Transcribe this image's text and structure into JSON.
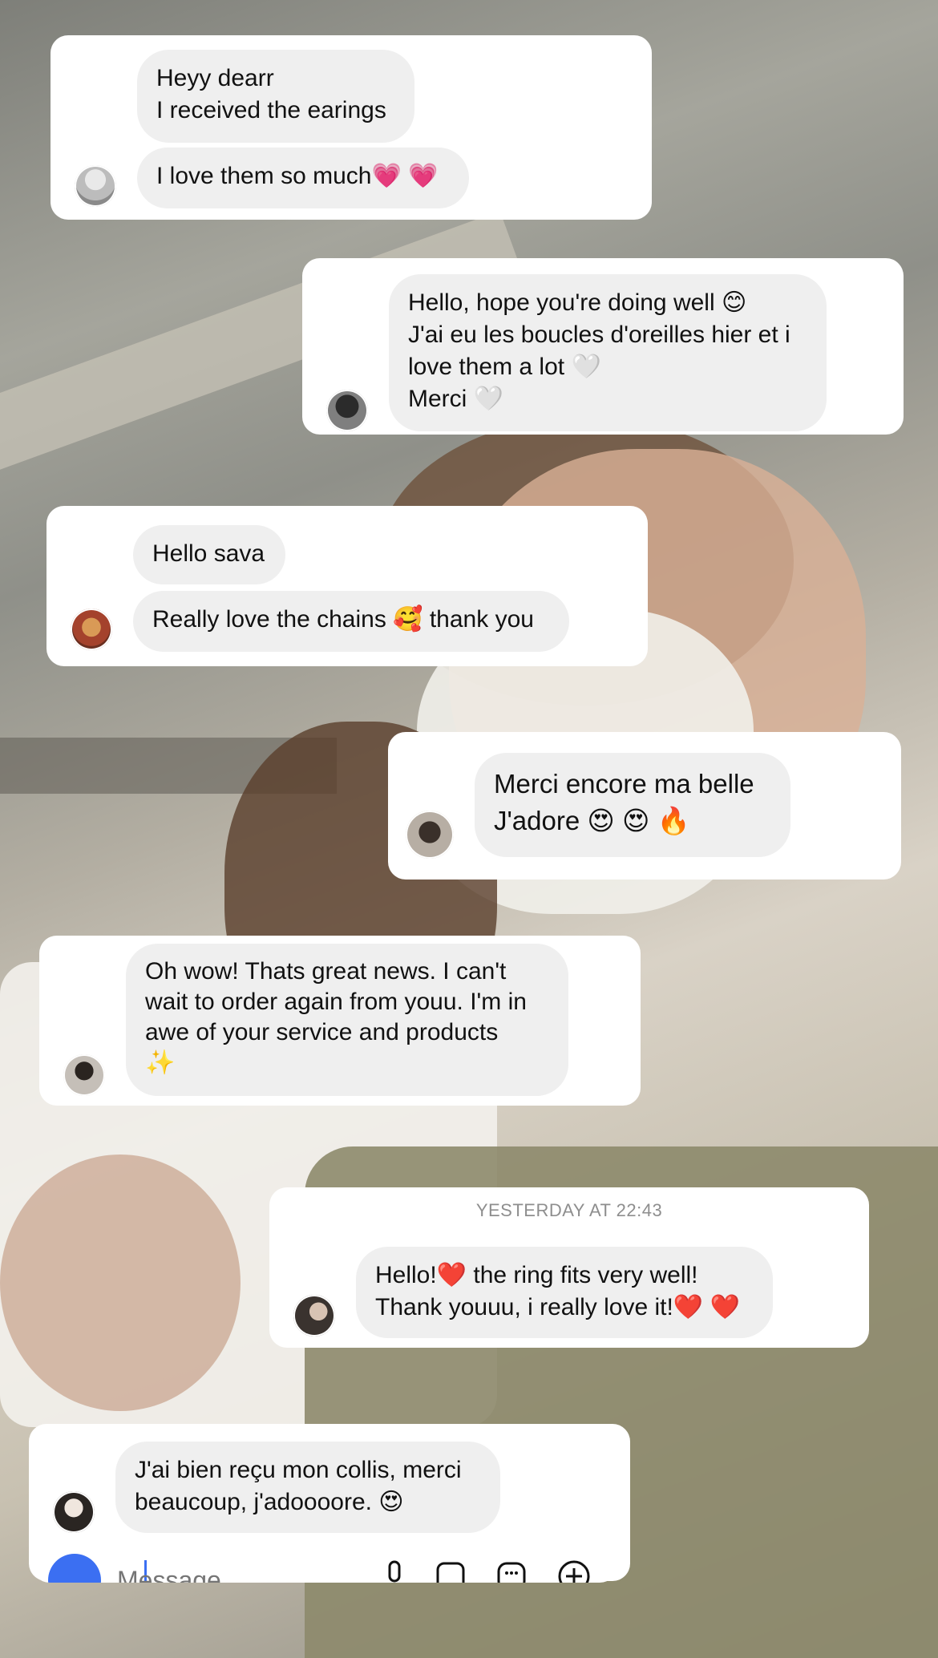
{
  "conversations": [
    {
      "messages": [
        "Heyy dearr\nI received the earings",
        "I love them so much💗 💗"
      ]
    },
    {
      "messages": [
        "Hello, hope you're doing well 😊\nJ'ai eu les boucles d'oreilles hier et i\nlove them a lot 🤍\nMerci 🤍"
      ]
    },
    {
      "messages": [
        "Hello sava",
        "Really love the chains 🥰 thank you"
      ]
    },
    {
      "messages": [
        "Merci encore ma belle\nJ'adore 😍 😍 🔥"
      ]
    },
    {
      "messages": [
        "Oh wow! Thats great news. I can't\nwait to order again from youu. I'm in\nawe of your service and products\n✨"
      ]
    },
    {
      "timestamp": "YESTERDAY AT 22:43",
      "messages": [
        "Hello!❤️  the ring fits very well!\nThank youuu, i really love it!❤️ ❤️"
      ]
    },
    {
      "messages": [
        "J'ai bien reçu mon collis, merci\nbeaucoup, j'adoooore. 😍"
      ]
    }
  ],
  "composer": {
    "placeholder": "Message",
    "icons": [
      "camera-icon",
      "microphone-icon",
      "gallery-icon",
      "sticker-icon",
      "plus-icon"
    ]
  }
}
